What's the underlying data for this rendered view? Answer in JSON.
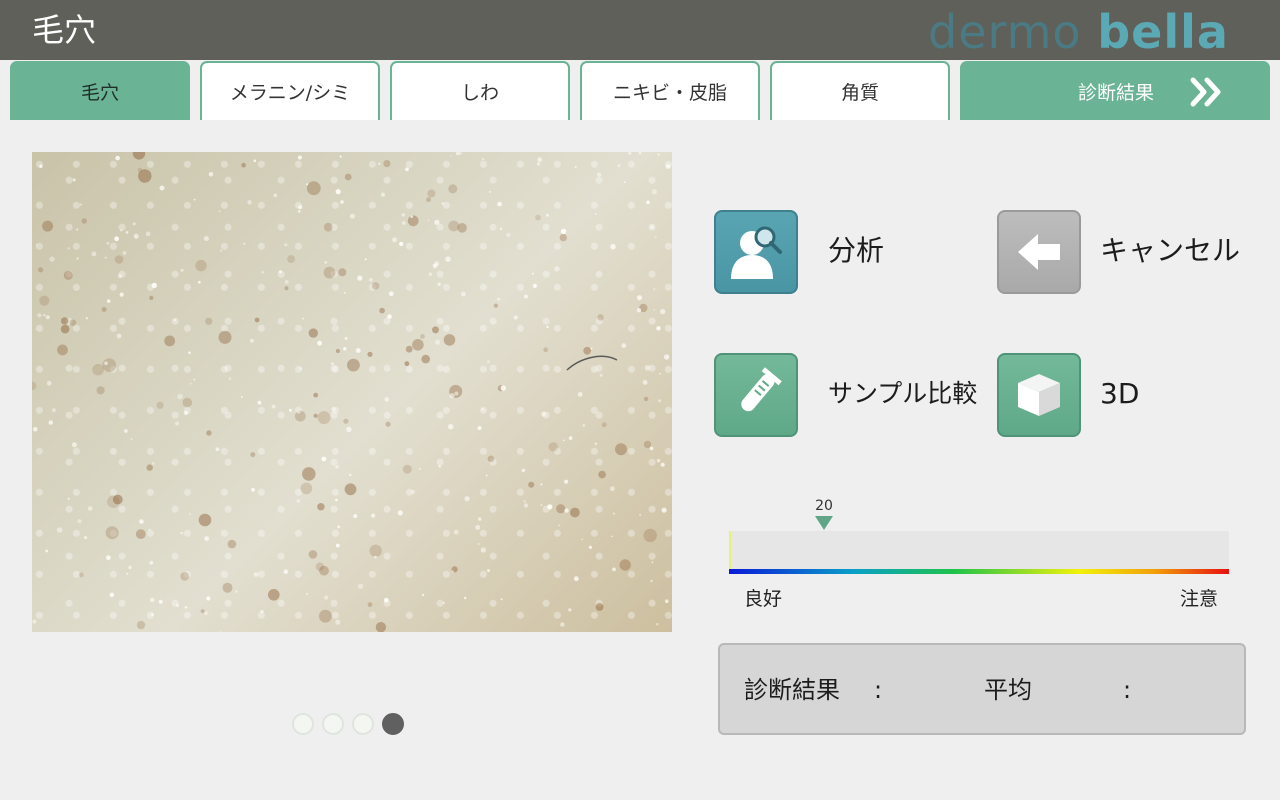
{
  "header": {
    "title": "毛穴",
    "logo_part1": "dermo",
    "logo_part2": "bella"
  },
  "tabs": [
    {
      "label": "毛穴",
      "active": true
    },
    {
      "label": "メラニン/シミ",
      "active": false
    },
    {
      "label": "しわ",
      "active": false
    },
    {
      "label": "ニキビ・皮脂",
      "active": false
    },
    {
      "label": "角質",
      "active": false
    }
  ],
  "result_tab": {
    "label": "診断結果",
    "icon": "double-chevron-right-icon"
  },
  "actions": {
    "analyze_label": "分析",
    "analyze_icon": "person-magnifier-icon",
    "cancel_label": "キャンセル",
    "cancel_icon": "arrow-left-icon",
    "sample_compare_label": "サンプル比較",
    "sample_compare_icon": "test-tube-icon",
    "three_d_label": "3D",
    "three_d_icon": "cube-icon"
  },
  "gauge": {
    "value": "20",
    "fraction": 0.19,
    "good_label": "良好",
    "caution_label": "注意",
    "colors": [
      "#0a1ad8",
      "#0aa0c8",
      "#1fc34a",
      "#f2f20a",
      "#f2a00a",
      "#e81010"
    ],
    "marker_color": "#5ea687"
  },
  "result_box": {
    "diagnosis_label": "診断結果",
    "colon1": ":",
    "average_label": "平均",
    "colon2": ":"
  },
  "pager": {
    "count": 4,
    "active_index": 3
  },
  "colors": {
    "topbar": "#5f605a",
    "accent_green": "#6ab394",
    "teal": "#4a95a4"
  }
}
